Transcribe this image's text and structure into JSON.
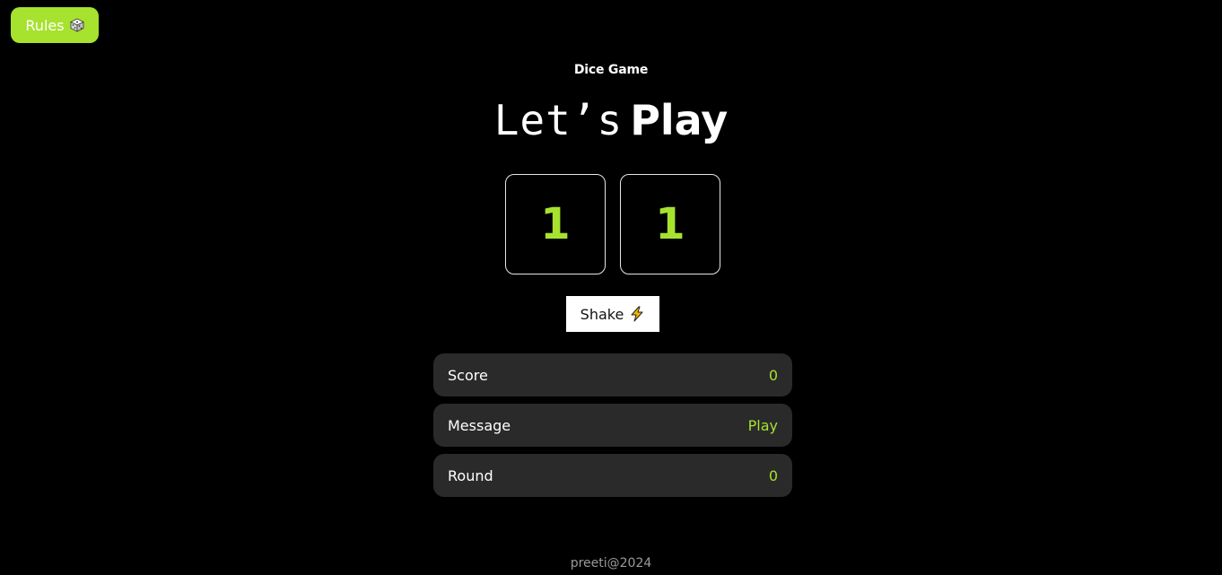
{
  "rules_button": {
    "label": "Rules",
    "icon": "dice-icon"
  },
  "header": {
    "eyebrow": "Dice Game",
    "title_light": "Let’s",
    "title_bold": "Play"
  },
  "dice": [
    {
      "value": "1"
    },
    {
      "value": "1"
    }
  ],
  "shake_button": {
    "label": "Shake",
    "icon": "lightning-icon"
  },
  "stats": {
    "score": {
      "label": "Score",
      "value": "0"
    },
    "message": {
      "label": "Message",
      "value": "Play"
    },
    "round": {
      "label": "Round",
      "value": "0"
    }
  },
  "footer": {
    "text": "preeti@2024"
  },
  "colors": {
    "accent": "#a6e22e",
    "background": "#000000",
    "row_background": "#2a2a2a"
  }
}
